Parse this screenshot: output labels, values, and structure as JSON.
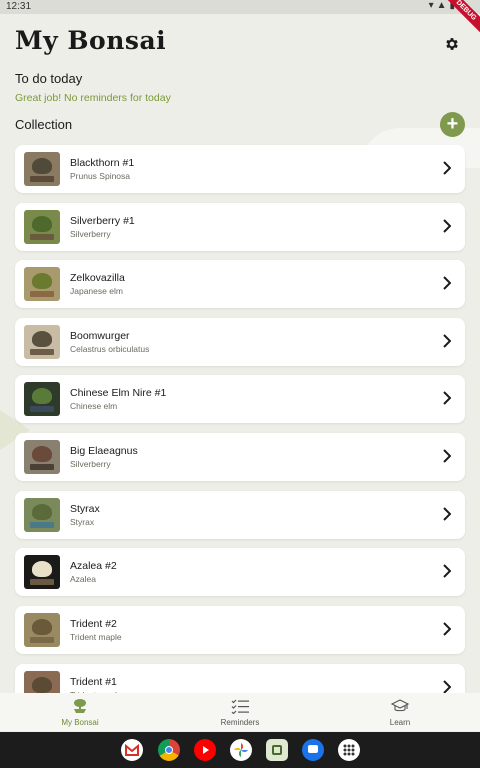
{
  "status": {
    "time": "12:31",
    "icons": "▾▲▮",
    "debug": "DEBUG"
  },
  "header": {
    "title": "My Bonsai"
  },
  "todo": {
    "title": "To do today",
    "message": "Great job! No reminders for today"
  },
  "collection": {
    "title": "Collection",
    "items": [
      {
        "name": "Blackthorn #1",
        "species": "Prunus Spinosa"
      },
      {
        "name": "Silverberry #1",
        "species": "Silverberry"
      },
      {
        "name": "Zelkovazilla",
        "species": "Japanese elm"
      },
      {
        "name": "Boomwurger",
        "species": "Celastrus orbiculatus"
      },
      {
        "name": "Chinese Elm Nire #1",
        "species": "Chinese elm"
      },
      {
        "name": "Big Elaeagnus",
        "species": "Silverberry"
      },
      {
        "name": "Styrax",
        "species": "Styrax"
      },
      {
        "name": "Azalea #2",
        "species": "Azalea"
      },
      {
        "name": "Trident #2",
        "species": "Trident maple"
      },
      {
        "name": "Trident #1",
        "species": "Trident maple"
      }
    ]
  },
  "nav": {
    "my_bonsai": "My Bonsai",
    "reminders": "Reminders",
    "learn": "Learn"
  },
  "colors": {
    "accent": "#7f9a4c",
    "accent_text": "#6d8a38"
  }
}
